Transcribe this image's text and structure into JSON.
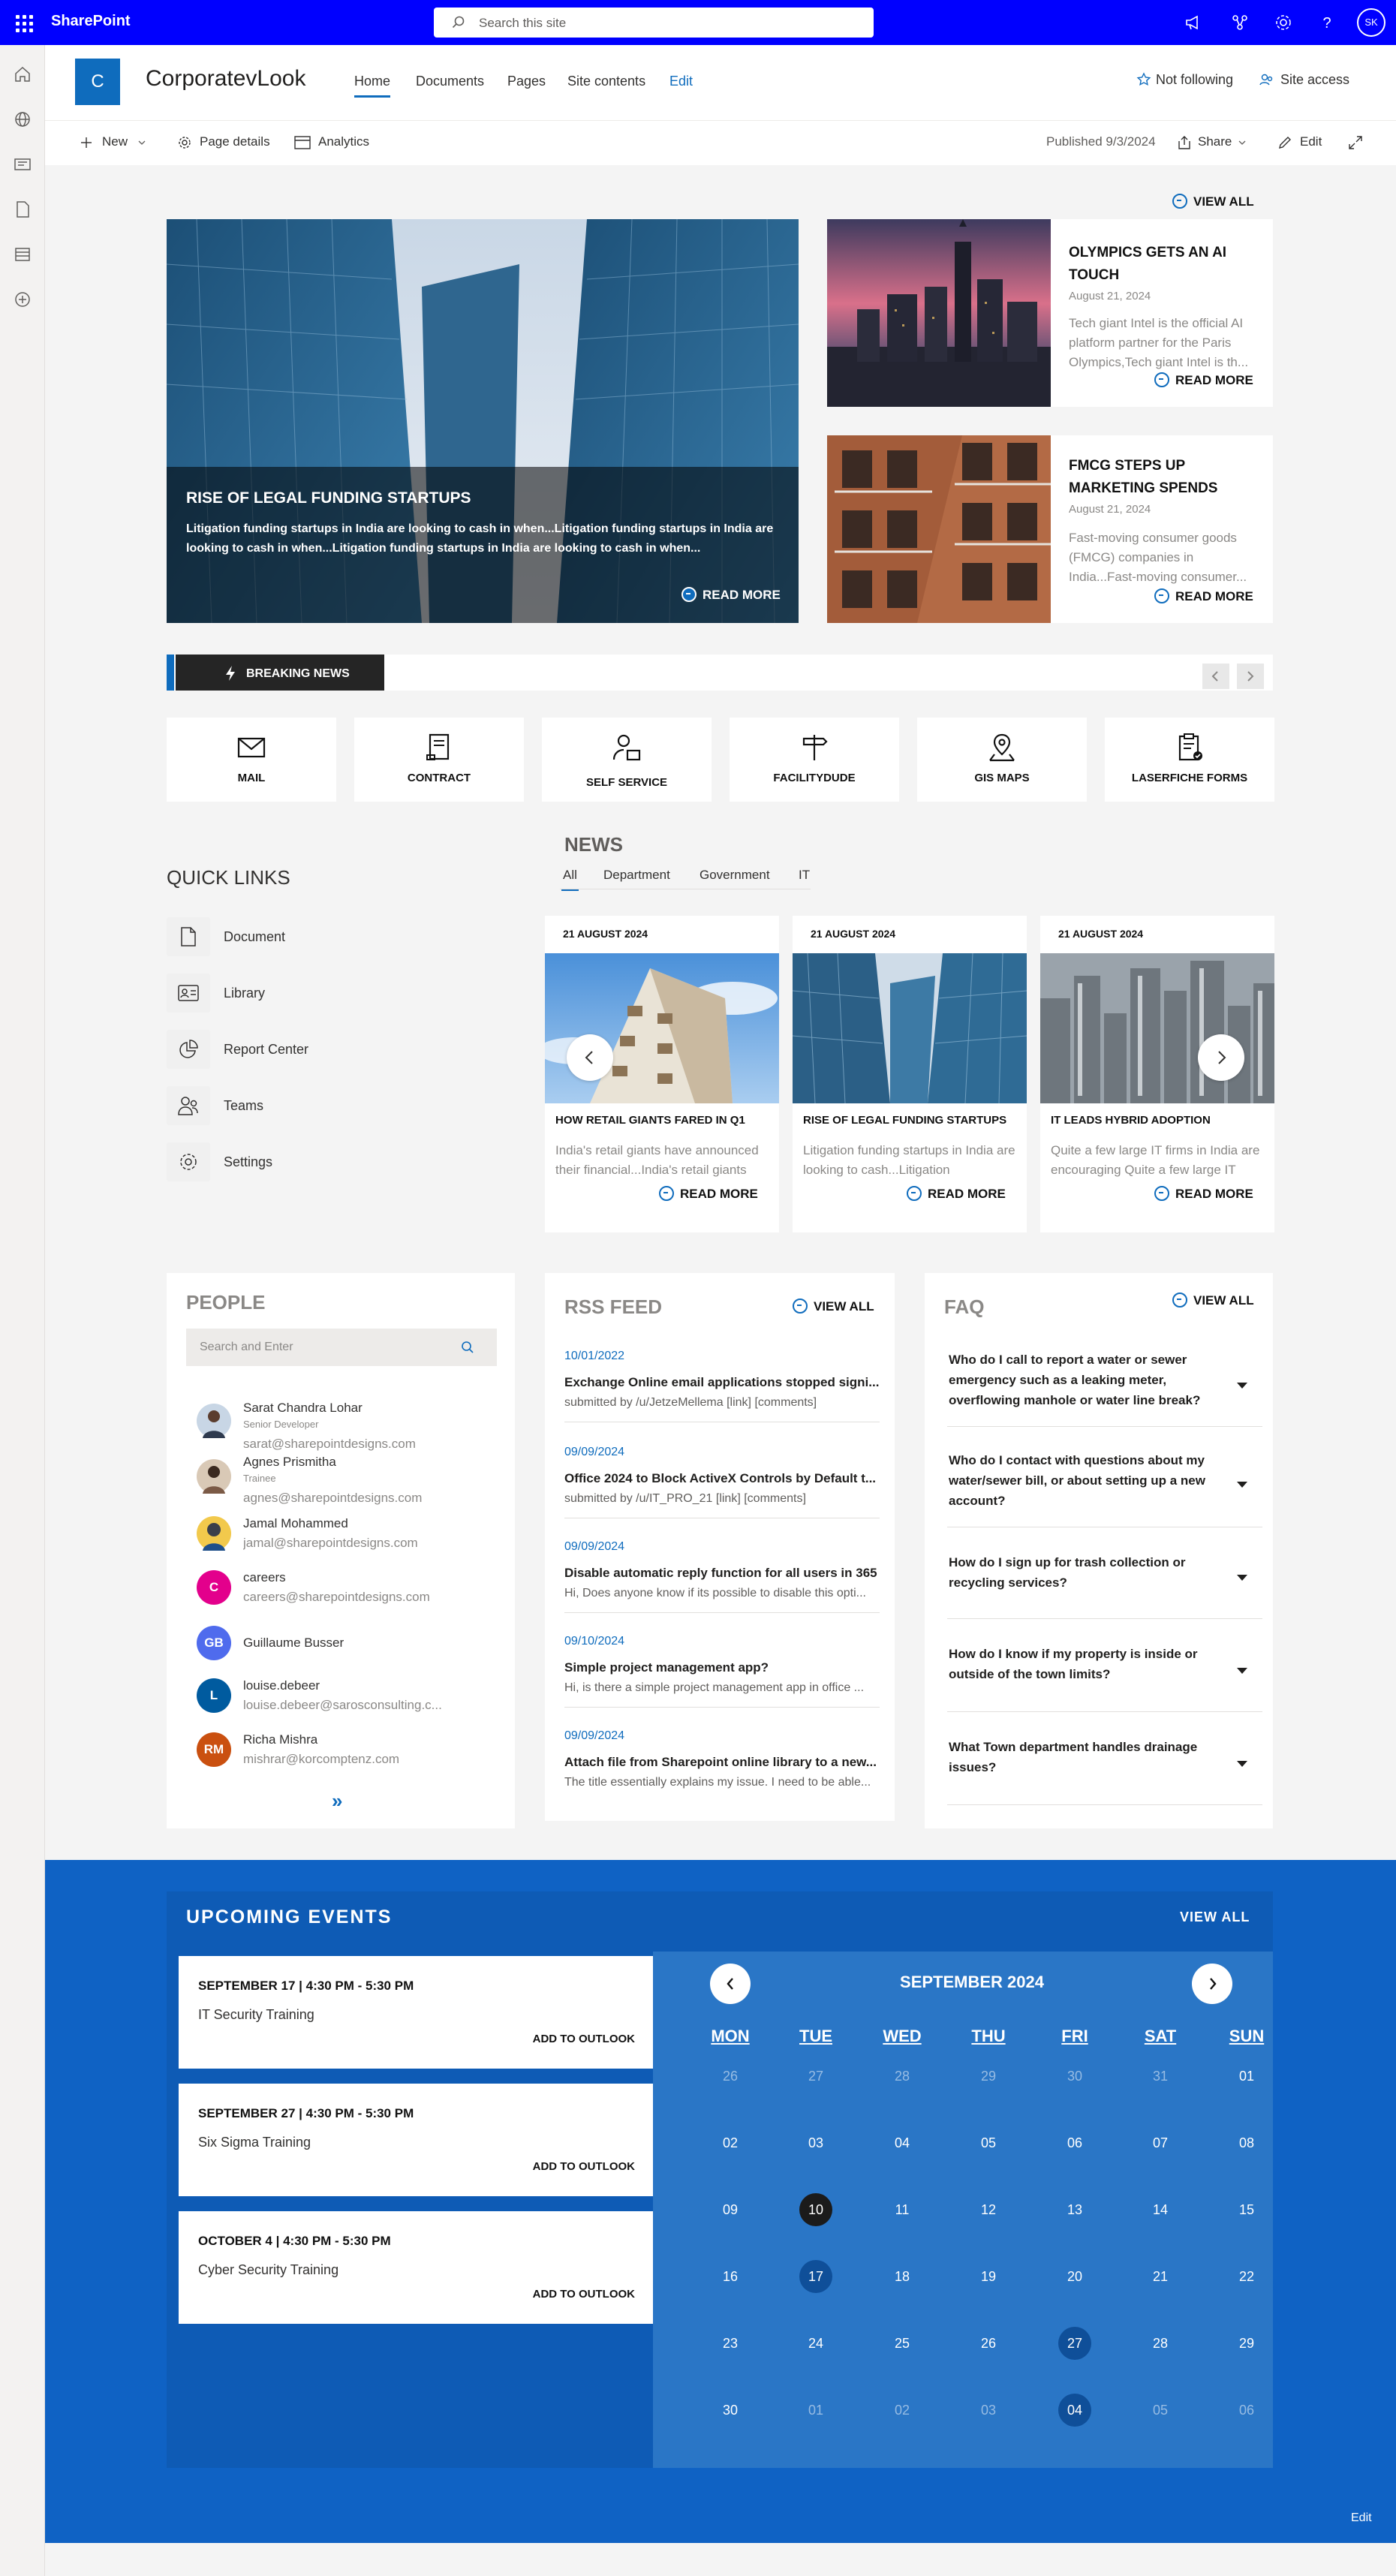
{
  "topbar": {
    "brand": "SharePoint",
    "search_placeholder": "Search this site",
    "avatar": "SK",
    "icons": [
      "waffle-icon",
      "megaphone-icon",
      "share-network-icon",
      "gear-icon",
      "help-icon"
    ],
    "color": "#0000ff"
  },
  "rail": {
    "icons": [
      "home-icon",
      "globe-icon",
      "news-icon",
      "file-icon",
      "list-icon",
      "add-icon"
    ]
  },
  "site": {
    "logo_letter": "C",
    "name": "CorporatevLook",
    "nav": [
      "Home",
      "Documents",
      "Pages",
      "Site contents",
      "Edit"
    ],
    "not_following": "Not following",
    "site_access": "Site access"
  },
  "commandbar": {
    "new": "New",
    "page_details": "Page details",
    "analytics": "Analytics",
    "published": "Published 9/3/2024",
    "share": "Share",
    "edit": "Edit"
  },
  "hero": {
    "view_all": "VIEW ALL",
    "main": {
      "title": "RISE OF LEGAL FUNDING STARTUPS",
      "excerpt": "Litigation funding startups in India are looking to cash in when...Litigation funding startups in India are looking to cash in when...Litigation funding startups in India are looking to cash in when...",
      "read_more": "READ MORE"
    },
    "side": [
      {
        "title": "OLYMPICS GETS AN AI TOUCH",
        "date": "August 21, 2024",
        "excerpt": "Tech giant Intel is the official AI platform partner for the Paris Olympics,Tech giant Intel is th...",
        "read_more": "READ MORE"
      },
      {
        "title": "FMCG STEPS UP MARKETING SPENDS",
        "date": "August 21, 2024",
        "excerpt": "Fast-moving consumer goods (FMCG) companies in India...Fast-moving consumer...",
        "read_more": "READ MORE"
      }
    ]
  },
  "breaking": {
    "label": "BREAKING NEWS"
  },
  "tiles": [
    {
      "label": "MAIL",
      "icon": "mail-icon"
    },
    {
      "label": "CONTRACT",
      "icon": "contract-icon"
    },
    {
      "label": "SELF SERVICE",
      "icon": "self-service-icon"
    },
    {
      "label": "FACILITYDUDE",
      "icon": "signpost-icon"
    },
    {
      "label": "GIS MAPS",
      "icon": "map-pin-icon"
    },
    {
      "label": "LASERFICHE FORMS",
      "icon": "clipboard-check-icon"
    }
  ],
  "quick_links": {
    "title": "QUICK LINKS",
    "items": [
      {
        "label": "Document",
        "icon": "document-icon"
      },
      {
        "label": "Library",
        "icon": "contact-card-icon"
      },
      {
        "label": "Report Center",
        "icon": "pie-chart-icon"
      },
      {
        "label": "Teams",
        "icon": "people-icon"
      },
      {
        "label": "Settings",
        "icon": "gear-icon"
      }
    ]
  },
  "news": {
    "title": "NEWS",
    "tabs": [
      "All",
      "Department",
      "Government",
      "IT"
    ],
    "cards": [
      {
        "date": "21 AUGUST 2024",
        "title": "HOW RETAIL GIANTS FARED IN Q1",
        "excerpt": "India's retail giants have announced their financial...India's retail giants",
        "read_more": "READ MORE"
      },
      {
        "date": "21 AUGUST 2024",
        "title": "RISE OF LEGAL FUNDING STARTUPS",
        "excerpt": "Litigation funding startups in India are looking to cash...Litigation",
        "read_more": "READ MORE"
      },
      {
        "date": "21 AUGUST 2024",
        "title": "IT LEADS HYBRID ADOPTION",
        "excerpt": "Quite a few large IT firms in India are encouraging Quite a few large IT",
        "read_more": "READ MORE"
      }
    ]
  },
  "people": {
    "title": "PEOPLE",
    "search_placeholder": "Search and Enter",
    "list": [
      {
        "name": "Sarat Chandra Lohar",
        "role": "Senior Developer",
        "email": "sarat@sharepointdesigns.com",
        "initials": "",
        "color": "#c8d6e5"
      },
      {
        "name": "Agnes Prismitha",
        "role": "Trainee",
        "email": "agnes@sharepointdesigns.com",
        "initials": "",
        "color": "#d9c9b6"
      },
      {
        "name": "Jamal Mohammed",
        "role": "",
        "email": "jamal@sharepointdesigns.com",
        "initials": "",
        "color": "#f2c94c"
      },
      {
        "name": "careers",
        "role": "",
        "email": "careers@sharepointdesigns.com",
        "initials": "C",
        "color": "#e3008c"
      },
      {
        "name": "Guillaume Busser",
        "role": "",
        "email": "",
        "initials": "GB",
        "color": "#4f6bed"
      },
      {
        "name": "louise.debeer",
        "role": "",
        "email": "louise.debeer@sarosconsulting.c...",
        "initials": "L",
        "color": "#005b9f"
      },
      {
        "name": "Richa Mishra",
        "role": "",
        "email": "mishrar@korcomptenz.com",
        "initials": "RM",
        "color": "#ca5010"
      }
    ],
    "more": "»"
  },
  "rss": {
    "title": "RSS FEED",
    "view_all": "VIEW ALL",
    "items": [
      {
        "date": "10/01/2022",
        "title": "Exchange Online email applications stopped signi...",
        "sub": "submitted by /u/JetzeMellema [link] [comments]"
      },
      {
        "date": "09/09/2024",
        "title": "Office 2024 to Block ActiveX Controls by Default t...",
        "sub": "submitted by /u/IT_PRO_21 [link] [comments]"
      },
      {
        "date": "09/09/2024",
        "title": "Disable automatic reply function for all users in 365",
        "sub": "Hi, Does anyone know if its possible to disable this opti..."
      },
      {
        "date": "09/10/2024",
        "title": "Simple project management app?",
        "sub": "Hi, is there a simple project management app in office ..."
      },
      {
        "date": "09/09/2024",
        "title": "Attach file from Sharepoint online library to a new...",
        "sub": "The title essentially explains my issue. I need to be able..."
      }
    ]
  },
  "faq": {
    "title": "FAQ",
    "view_all": "VIEW ALL",
    "items": [
      "Who do I call to report a water or sewer emergency such as a leaking meter, overflowing manhole or water line break?",
      "Who do I contact with questions about my water/sewer bill, or about setting up a new account?",
      "How do I sign up for trash collection or recycling services?",
      "How do I know if my property is inside or outside of the town limits?",
      "What Town department handles drainage issues?"
    ]
  },
  "events": {
    "title": "UPCOMING EVENTS",
    "view_all": "VIEW ALL",
    "list": [
      {
        "date": "SEPTEMBER 17 | 4:30 PM  -  5:30 PM",
        "title": "IT Security Training",
        "add": "ADD TO OUTLOOK"
      },
      {
        "date": "SEPTEMBER 27 | 4:30 PM  -  5:30 PM",
        "title": "Six Sigma Training",
        "add": "ADD TO OUTLOOK"
      },
      {
        "date": "OCTOBER 4 | 4:30 PM  -  5:30 PM",
        "title": "Cyber Security Training",
        "add": "ADD TO OUTLOOK"
      }
    ],
    "calendar": {
      "month": "SEPTEMBER 2024",
      "weekdays": [
        "MON",
        "TUE",
        "WED",
        "THU",
        "FRI",
        "SAT",
        "SUN"
      ],
      "weeks": [
        [
          "26",
          "27",
          "28",
          "29",
          "30",
          "31",
          "01"
        ],
        [
          "02",
          "03",
          "04",
          "05",
          "06",
          "07",
          "08"
        ],
        [
          "09",
          "10",
          "11",
          "12",
          "13",
          "14",
          "15"
        ],
        [
          "16",
          "17",
          "18",
          "19",
          "20",
          "21",
          "22"
        ],
        [
          "23",
          "24",
          "25",
          "26",
          "27",
          "28",
          "29"
        ],
        [
          "30",
          "01",
          "02",
          "03",
          "04",
          "05",
          "06"
        ]
      ],
      "today": "10",
      "event_days": [
        "17",
        "27",
        "04"
      ]
    },
    "footer_edit": "Edit"
  }
}
